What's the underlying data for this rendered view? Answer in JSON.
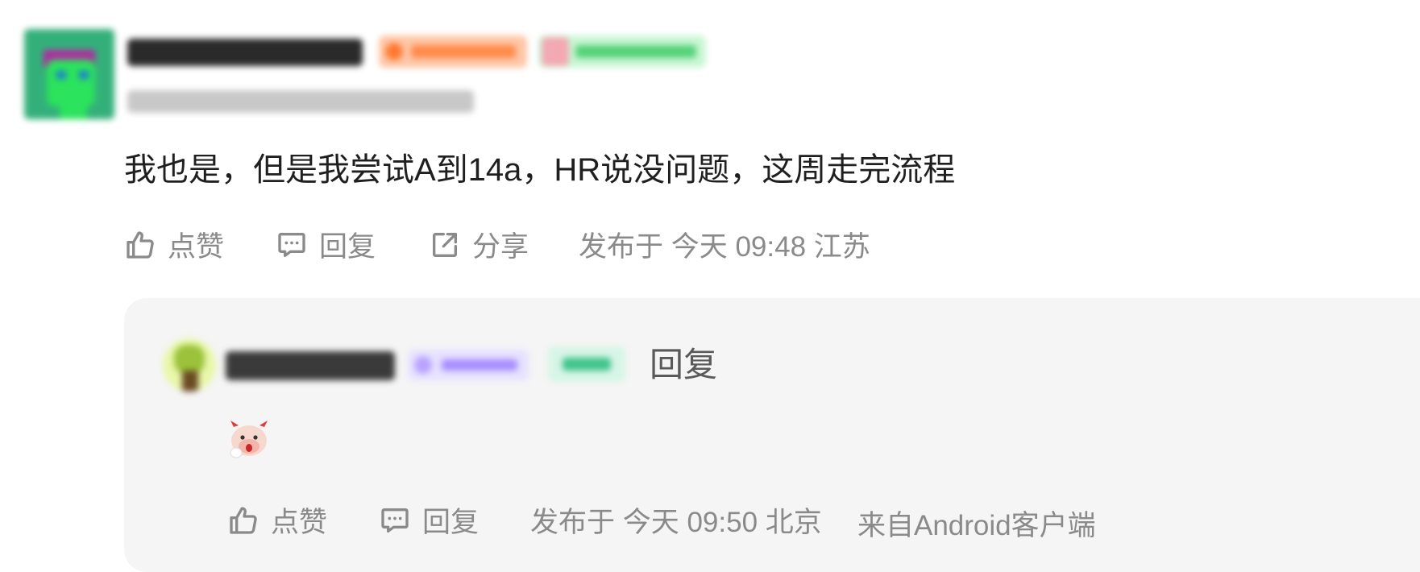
{
  "comment": {
    "text": "我也是，但是我尝试A到14a，HR说没问题，这周走完流程",
    "actions": {
      "like_label": "点赞",
      "reply_label": "回复",
      "share_label": "分享"
    },
    "meta": "发布于 今天 09:48 江苏"
  },
  "reply": {
    "reply_label": "回复",
    "actions": {
      "like_label": "点赞",
      "reply_label": "回复"
    },
    "meta": "发布于 今天 09:50 北京",
    "source": "来自Android客户端"
  },
  "icons": {
    "like": "thumbs-up-icon",
    "reply": "comment-icon",
    "share": "share-icon",
    "emoji": "bull-emoji"
  },
  "colors": {
    "action_gray": "#8a8a8a",
    "reply_panel_bg": "#f5f5f5",
    "text_dark": "#1f1f1f"
  }
}
